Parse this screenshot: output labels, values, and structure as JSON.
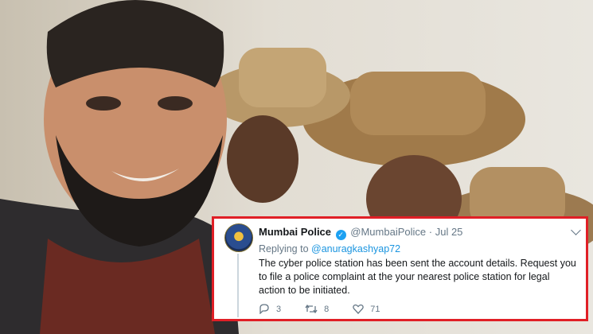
{
  "tweet": {
    "display_name": "Mumbai Police",
    "handle": "@MumbaiPolice",
    "separator": "·",
    "date": "Jul 25",
    "replying_prefix": "Replying to ",
    "replying_handle": "@anuragkashyap72",
    "body": "The cyber police station has been sent the account details. Request you to file a police complaint at the your nearest  police station for legal action to be initiated.",
    "replies": "3",
    "retweets": "8",
    "likes": "71",
    "verified_icon": "verified-badge-icon",
    "colors": {
      "highlight_border": "#e01f26",
      "link": "#1b95e0",
      "verified": "#1da1f2"
    }
  }
}
